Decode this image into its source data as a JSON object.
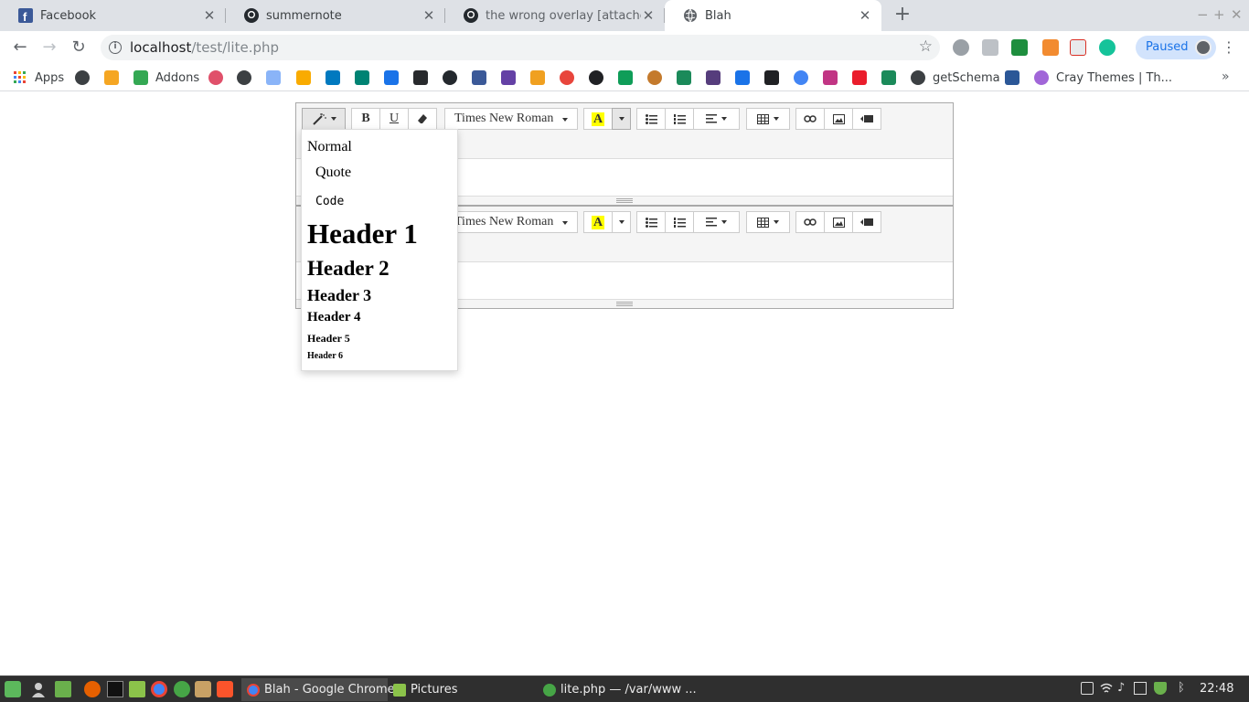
{
  "tabs": [
    {
      "title": "Facebook",
      "icon": "facebook-icon"
    },
    {
      "title": "summernote",
      "icon": "github-icon"
    },
    {
      "title": "the wrong overlay [attached the",
      "icon": "github-icon"
    },
    {
      "title": "Blah",
      "icon": "globe-icon"
    }
  ],
  "address": {
    "host": "localhost",
    "path": "/test/lite.php"
  },
  "profile": {
    "label": "Paused"
  },
  "bookmarks": {
    "apps": "Apps",
    "addons": "Addons",
    "getschema": "getSchema",
    "cray": "Cray Themes | Th..."
  },
  "editor": {
    "bold": "B",
    "underline": "U",
    "font_name": "Times New Roman",
    "highlight": "A"
  },
  "style_menu": {
    "normal": "Normal",
    "quote": "Quote",
    "code": "Code",
    "h1": "Header 1",
    "h2": "Header 2",
    "h3": "Header 3",
    "h4": "Header 4",
    "h5": "Header 5",
    "h6": "Header 6"
  },
  "taskbar": {
    "chrome_task": "Blah - Google Chrome",
    "files_task": "Pictures",
    "editor_task": "lite.php — /var/www ...",
    "clock": "22:48"
  },
  "colors": {
    "tab_bar": "#dee1e6",
    "highlight": "#ffff00",
    "taskbar": "#2f2f2f"
  }
}
